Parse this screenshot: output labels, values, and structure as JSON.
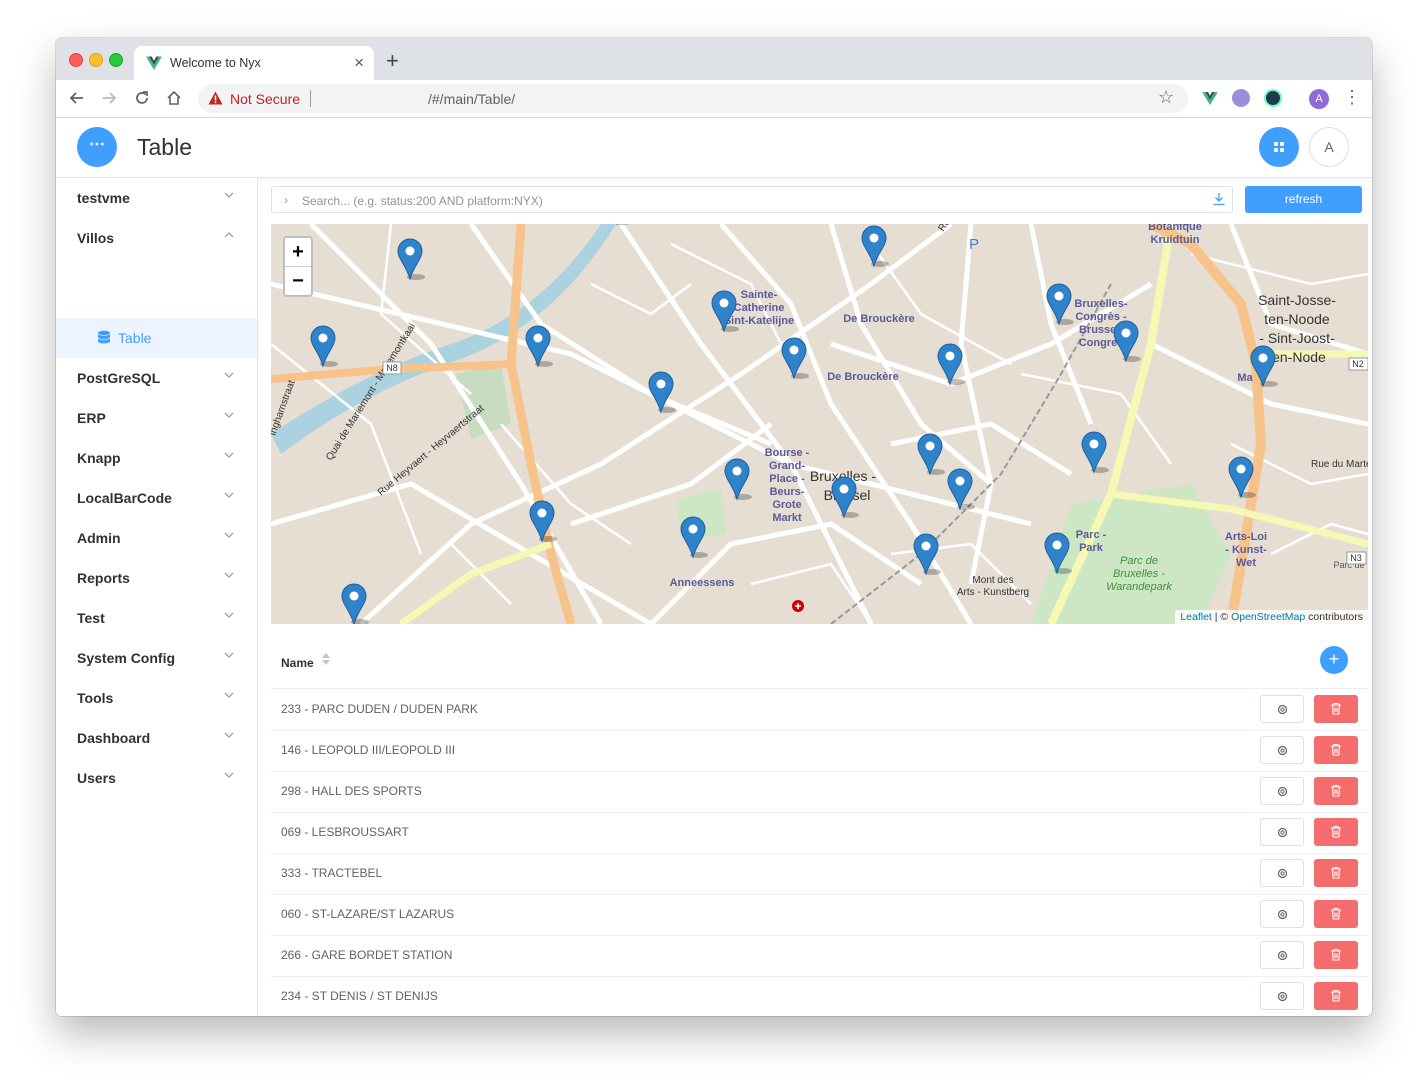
{
  "browser": {
    "tab_title": "Welcome to Nyx",
    "new_tab": "+",
    "security_label": "Not Secure",
    "url": "/#/main/Table/",
    "profile_initial": "A"
  },
  "header": {
    "menu_icon": "⋯",
    "title": "Table",
    "avatar_initial": "A"
  },
  "sidebar": {
    "items": [
      {
        "label": "testvme",
        "expanded": false
      },
      {
        "label": "Villos",
        "expanded": true
      },
      {
        "label": "PostGreSQL",
        "expanded": false
      },
      {
        "label": "ERP",
        "expanded": false
      },
      {
        "label": "Knapp",
        "expanded": false
      },
      {
        "label": "LocalBarCode",
        "expanded": false
      },
      {
        "label": "Admin",
        "expanded": false
      },
      {
        "label": "Reports",
        "expanded": false
      },
      {
        "label": "Test",
        "expanded": false
      },
      {
        "label": "System Config",
        "expanded": false
      },
      {
        "label": "Tools",
        "expanded": false
      },
      {
        "label": "Dashboard",
        "expanded": false
      },
      {
        "label": "Users",
        "expanded": false
      }
    ],
    "active_sub": "Table"
  },
  "search": {
    "placeholder": "Search... (e.g. status:200 AND platform:NYX)",
    "value": "",
    "refresh_label": "refresh"
  },
  "map": {
    "zoom_in": "+",
    "zoom_out": "−",
    "attribution_leaflet": "Leaflet",
    "attribution_sep": " | © ",
    "attribution_osm": "OpenStreetMap",
    "attribution_rest": " contributors",
    "labels": {
      "sainte_catherine": "Sainte-",
      "catherine2": "Catherine",
      "katelijne": "Sint-Katelijne",
      "de_brouckere_1": "De Brouckère",
      "de_brouckere_2": "De Brouckère",
      "bruxelles_congres_1": "Bruxelles-",
      "bruxelles_congres_2": "Congrès -",
      "bruxelles_congres_3": "Brussel-",
      "bruxelles_congres_4": "Congres",
      "botanique_1": "Botanique",
      "botanique_2": "Kruidtuin",
      "saint_josse_1": "Saint-Josse-",
      "saint_josse_2": "ten-Noode",
      "saint_josse_3": "- Sint-Joost-",
      "saint_josse_4": "ten-Node",
      "madou": "Ma",
      "bourse_1": "Bourse -",
      "bourse_2": "Grand-",
      "bourse_3": "Place -",
      "bourse_4": "Beurs-",
      "bourse_5": "Grote",
      "bourse_6": "Markt",
      "bruxelles_1": "Bruxelles -",
      "bruxelles_2": "Brussel",
      "anneessens": "Anneessens",
      "mont_des_arts_1": "Mont des",
      "mont_des_arts_2": "Arts - Kunstberg",
      "parc_1": "Parc -",
      "parc_2": "Park",
      "parc_bruxelles_1": "Parc de",
      "parc_bruxelles_2": "Bruxelles -",
      "parc_bruxelles_3": "Warandepark",
      "arts_loi_1": "Arts-Loi",
      "arts_loi_2": "- Kunst-",
      "arts_loi_3": "Wet",
      "n8": "N8",
      "n2": "N2",
      "n3": "N3",
      "parking": "P",
      "quai_de_mariemont": "Quai de Mariemont - Mariemontkaai",
      "rue_heyvaert": "Rue Heyvaert - Heyvaertstraat",
      "ninghamstraat": "inghamstraat",
      "rue_du_marteau": "Rue du Marteau - Hamers",
      "rue_neuve": "Rue Neuve"
    }
  },
  "table": {
    "column_name": "Name",
    "add_label": "+",
    "rows": [
      "233 - PARC DUDEN / DUDEN PARK",
      "146 - LEOPOLD III/LEOPOLD III",
      "298 - HALL DES SPORTS",
      "069 - LESBROUSSART",
      "333 - TRACTEBEL",
      "060 - ST-LAZARE/ST LAZARUS",
      "266 - GARE BORDET STATION",
      "234 - ST DENIS / ST DENIJS"
    ]
  },
  "colors": {
    "primary": "#409eff",
    "danger": "#f56c6c",
    "marker": "#2e83cb"
  }
}
